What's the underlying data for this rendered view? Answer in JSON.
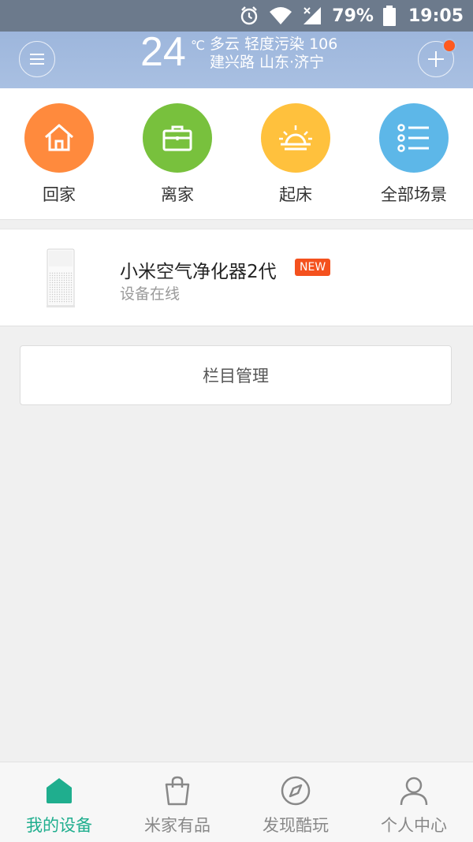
{
  "status_bar": {
    "battery": "79%",
    "time": "19:05"
  },
  "header": {
    "temperature": "24",
    "unit": "℃",
    "weather": "多云 轻度污染 106",
    "location": "建兴路 山东·济宁",
    "menu_icon": "menu-icon",
    "add_icon": "plus-icon"
  },
  "scenes": [
    {
      "label": "回家",
      "color": "#ff8a3d",
      "icon": "home-icon"
    },
    {
      "label": "离家",
      "color": "#78c13d",
      "icon": "briefcase-icon"
    },
    {
      "label": "起床",
      "color": "#ffc13d",
      "icon": "sunrise-icon"
    },
    {
      "label": "全部场景",
      "color": "#5db7e8",
      "icon": "list-icon"
    }
  ],
  "device": {
    "name": "小米空气净化器2代",
    "badge": "NEW",
    "status": "设备在线"
  },
  "manage": {
    "label": "栏目管理"
  },
  "bottom_nav": [
    {
      "label": "我的设备",
      "active": true
    },
    {
      "label": "米家有品",
      "active": false
    },
    {
      "label": "发现酷玩",
      "active": false
    },
    {
      "label": "个人中心",
      "active": false
    }
  ],
  "colors": {
    "accent": "#1fae8e",
    "badge": "#f4511e"
  }
}
